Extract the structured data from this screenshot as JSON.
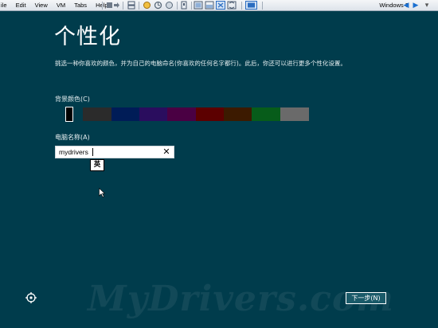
{
  "vm_toolbar": {
    "menu": [
      "ile",
      "Edit",
      "View",
      "VM",
      "Tabs",
      "Help"
    ],
    "vm_name": "Windows 7"
  },
  "personalize": {
    "title": "个性化",
    "description": "挑选一种你喜欢的颜色，并为自己的电脑命名(你喜欢的任何名字都行)。此后，你还可以进行更多个性化设置。",
    "background_color_label": "背景颜色(C)",
    "colors": [
      "#003c4c",
      "#000000",
      "#003c4c",
      "#2b2b2b",
      "#001c57",
      "#2a0d5e",
      "#4a0043",
      "#5c0000",
      "#3c1a00",
      "#075c1a",
      "#6a6a6a"
    ],
    "selected_color": "#003c4c",
    "pc_name_label": "电脑名称(A)",
    "pc_name_value": "mydrivers",
    "ime_indicator": "英",
    "next_button": "下一步(N)"
  },
  "watermark": "MyDrivers.com"
}
